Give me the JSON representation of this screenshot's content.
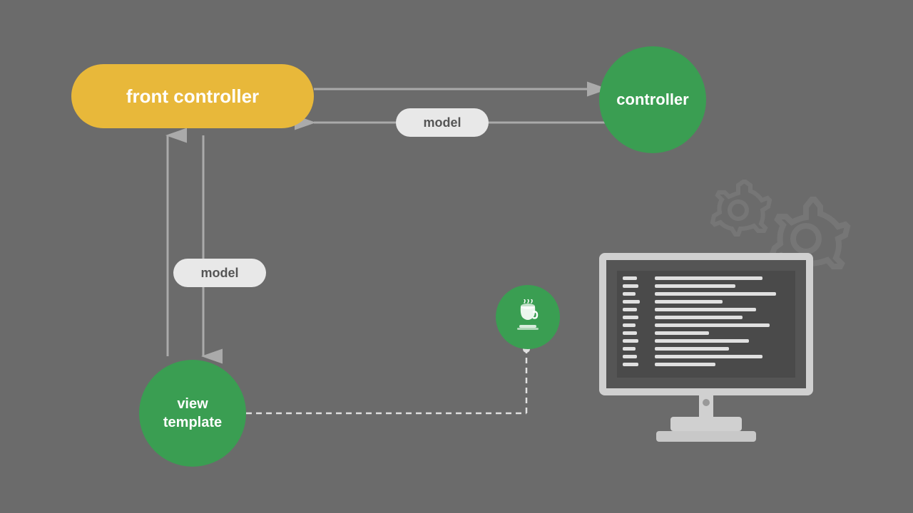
{
  "diagram": {
    "background_color": "#6b6b6b",
    "nodes": {
      "front_controller": {
        "label": "front controller",
        "color": "#e8b83a",
        "type": "pill"
      },
      "controller": {
        "label": "controller",
        "color": "#3a9e52",
        "type": "circle"
      },
      "view_template": {
        "label": "view\ntemplate",
        "label_line1": "view",
        "label_line2": "template",
        "color": "#3a9e52",
        "type": "circle"
      },
      "model_horizontal": {
        "label": "model",
        "color": "#e8e8e8"
      },
      "model_vertical": {
        "label": "model",
        "color": "#e8e8e8"
      }
    }
  }
}
